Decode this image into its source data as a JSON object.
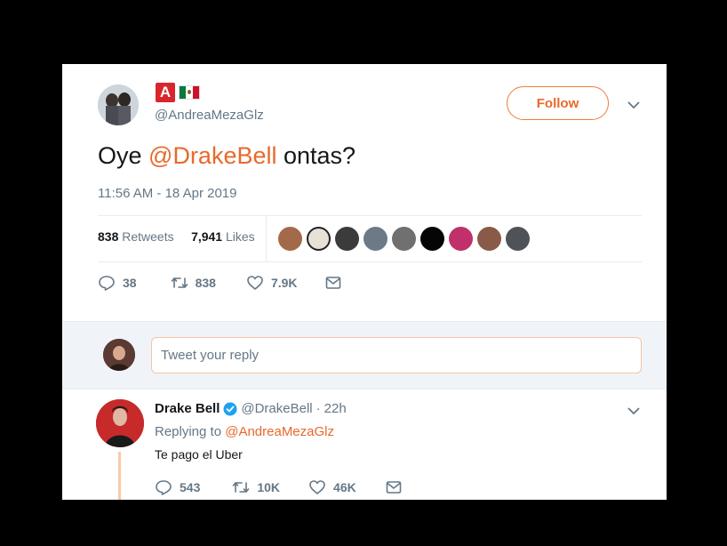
{
  "tweet": {
    "badge_letter": "A",
    "handle": "@AndreaMezaGlz",
    "follow_label": "Follow",
    "text_before": "Oye ",
    "mention": "@DrakeBell",
    "text_after": " ontas?",
    "timestamp": "11:56 AM - 18 Apr 2019",
    "retweets_count": "838",
    "retweets_label": "Retweets",
    "likes_count": "7,941",
    "likes_label": "Likes",
    "actions": {
      "replies": "38",
      "retweets": "838",
      "likes": "7.9K"
    }
  },
  "reply_composer": {
    "placeholder": "Tweet your reply"
  },
  "reply": {
    "name": "Drake Bell",
    "handle": "@DrakeBell",
    "separator": "·",
    "time": "22h",
    "replying_prefix": "Replying to ",
    "replying_to": "@AndreaMezaGlz",
    "text": "Te pago el Uber",
    "actions": {
      "replies": "543",
      "retweets": "10K",
      "likes": "46K"
    }
  },
  "colors": {
    "accent": "#e8692b",
    "muted": "#657786",
    "verified": "#1da1f2"
  },
  "icons": [
    "reply-icon",
    "retweet-icon",
    "like-icon",
    "dm-icon",
    "chevron-down-icon",
    "verified-icon"
  ]
}
